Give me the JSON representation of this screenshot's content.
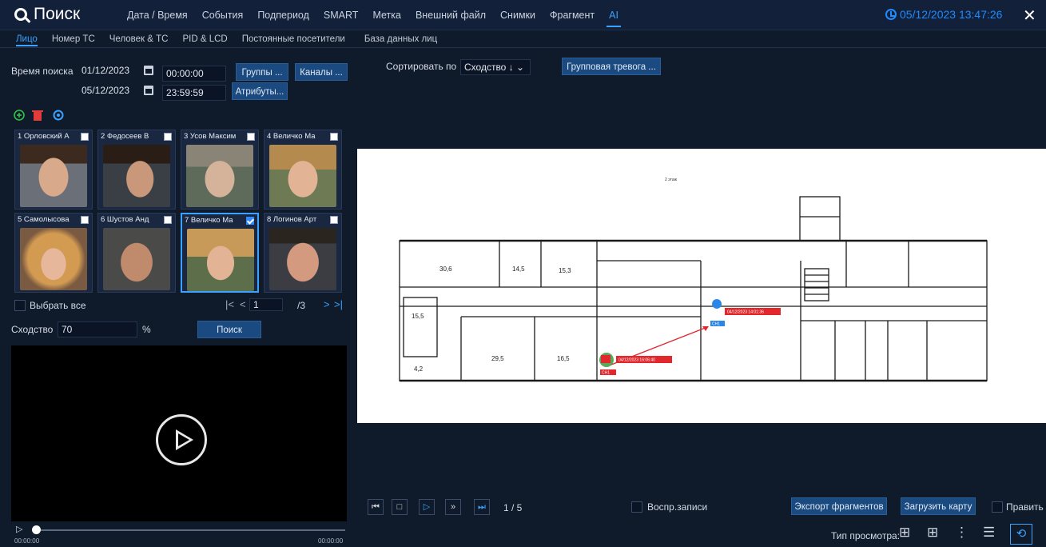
{
  "header": {
    "title": "Поиск",
    "nav": [
      "Дата / Время",
      "События",
      "Подпериод",
      "SMART",
      "Метка",
      "Внешний файл",
      "Снимки",
      "Фрагмент",
      "AI"
    ],
    "active_nav": "AI",
    "datetime": "05/12/2023 13:47:26"
  },
  "subtabs": [
    "Лицо",
    "Номер ТС",
    "Человек & ТС",
    "PID & LCD",
    "Постоянные посетители",
    "База данных лиц"
  ],
  "search": {
    "time_label": "Время поиска",
    "start_date": "01/12/2023",
    "start_time": "00:00:00",
    "end_date": "05/12/2023",
    "end_time": "23:59:59",
    "groups_btn": "Группы ...",
    "channels_btn": "Каналы ...",
    "attributes_btn": "Атрибуты..."
  },
  "faces": [
    {
      "label": "1 Орловский А",
      "checked": false
    },
    {
      "label": "2 Федосеев В",
      "checked": false
    },
    {
      "label": "3 Усов Максим",
      "checked": false
    },
    {
      "label": "4 Величко Ма",
      "checked": false
    },
    {
      "label": "5 Самолысова",
      "checked": false
    },
    {
      "label": "6 Шустов Анд",
      "checked": false
    },
    {
      "label": "7 Величко Ма",
      "checked": true
    },
    {
      "label": "8 Логинов Арт",
      "checked": false
    }
  ],
  "pager": {
    "select_all": "Выбрать все",
    "page": "1",
    "total": "/3"
  },
  "similarity": {
    "label": "Сходство",
    "value": "70",
    "unit": "%",
    "search_btn": "Поиск"
  },
  "player": {
    "time_start": "00:00:00",
    "time_end": "00:00:00"
  },
  "sort": {
    "label": "Сортировать по",
    "value": "Сходство ↓",
    "group_alarm_btn": "Групповая тревога ..."
  },
  "map": {
    "floor_label": "2 этаж",
    "rooms": [
      "30,6",
      "14,5",
      "15,3",
      "15,5",
      "29,5",
      "16,5",
      "4,2"
    ],
    "marker_a": {
      "time": "04/12/2023 14:01:36",
      "cam": "CH1"
    },
    "marker_b": {
      "time": "04/12/2023 16:06:40",
      "cam": "CH1"
    }
  },
  "playback": {
    "count": "1 / 5",
    "record_label": "Воспр.записи",
    "export_btn": "Экспорт фрагментов",
    "load_map_btn": "Загрузить карту",
    "edit_label": "Править",
    "view_type_label": "Тип просмотра:"
  },
  "colors": {
    "accent": "#3aa2ff",
    "route": "#e0282d",
    "marker_blue": "#2c86e8"
  }
}
